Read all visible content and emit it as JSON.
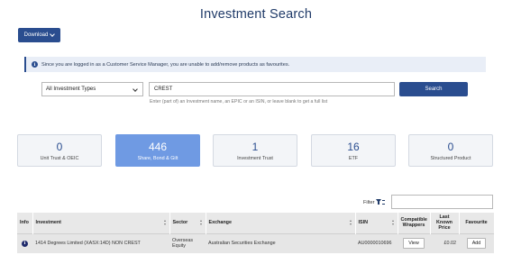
{
  "page": {
    "title": "Investment Search"
  },
  "toolbar": {
    "download_label": "Download"
  },
  "notice": {
    "icon": "info-icon",
    "text": "Since you are logged in as a Customer Service Manager, you are unable to add/remove products as favourites."
  },
  "search": {
    "type_selected": "All Investment Types",
    "query_value": "CREST",
    "button_label": "Search",
    "hint": "Enter (part of) an Investment name, an EPIC or an ISIN, or leave blank to get a full list"
  },
  "tiles": [
    {
      "count": "0",
      "label": "Unit Trust & OEIC",
      "active": false
    },
    {
      "count": "446",
      "label": "Share, Bond & Gilt",
      "active": true
    },
    {
      "count": "1",
      "label": "Investment Trust",
      "active": false
    },
    {
      "count": "16",
      "label": "ETF",
      "active": false
    },
    {
      "count": "0",
      "label": "Structured Product",
      "active": false
    }
  ],
  "filter": {
    "label": "Filter",
    "value": ""
  },
  "table": {
    "headers": {
      "info": "Info",
      "investment": "Investment",
      "sector": "Sector",
      "exchange": "Exchange",
      "isin": "ISIN",
      "compatible_wrappers": "Compatible Wrappers",
      "last_known_price": "Last Known Price",
      "favourite": "Favourite"
    },
    "rows": [
      {
        "investment": "1414 Degrees Limited (XASX:14D) NON CREST",
        "sector": "Overseas Equity",
        "exchange": "Australian Securities Exchange",
        "isin": "AU0000010696",
        "wrappers_button": "View",
        "last_known_price": "£0.02",
        "favourite_button": "Add"
      }
    ]
  },
  "colors": {
    "brand": "#2a4d8f",
    "title": "#1f3a68",
    "active_tile": "#6f9ae3",
    "notice_bg": "#e9eef7"
  }
}
